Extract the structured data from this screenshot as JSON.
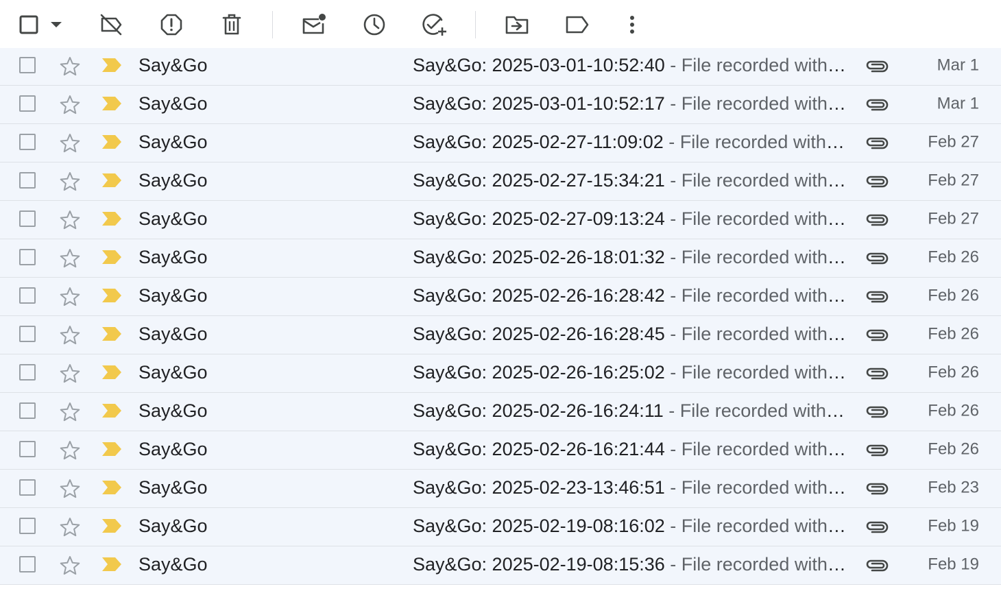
{
  "toolbar": {
    "buttons": [
      {
        "name": "select-all-checkbox"
      },
      {
        "name": "select-dropdown"
      },
      {
        "name": "not-important-button",
        "icon": "label-off-icon"
      },
      {
        "name": "report-spam-button",
        "icon": "report-icon"
      },
      {
        "name": "delete-button",
        "icon": "trash-icon"
      },
      {
        "name": "mark-unread-button",
        "icon": "mark-unread-icon"
      },
      {
        "name": "snooze-button",
        "icon": "clock-icon"
      },
      {
        "name": "add-to-tasks-button",
        "icon": "add-task-icon"
      },
      {
        "name": "move-to-button",
        "icon": "folder-move-icon"
      },
      {
        "name": "labels-button",
        "icon": "label-icon"
      },
      {
        "name": "more-button",
        "icon": "more-vert-icon"
      }
    ]
  },
  "colors": {
    "row_bg": "#f2f6fc",
    "importance": "#f2c94c",
    "icon": "#444746",
    "muted": "#5f6368"
  },
  "emails": [
    {
      "sender": "Say&Go",
      "subject": "Say&Go: 2025-03-01-10:52:40",
      "snippet": " - File recorded with Say&Go",
      "date": "Mar 1"
    },
    {
      "sender": "Say&Go",
      "subject": "Say&Go: 2025-03-01-10:52:17",
      "snippet": " - File recorded with Say&Go",
      "date": "Mar 1"
    },
    {
      "sender": "Say&Go",
      "subject": "Say&Go: 2025-02-27-11:09:02",
      "snippet": " - File recorded with Say&Go",
      "date": "Feb 27"
    },
    {
      "sender": "Say&Go",
      "subject": "Say&Go: 2025-02-27-15:34:21",
      "snippet": " - File recorded with Say&Go",
      "date": "Feb 27"
    },
    {
      "sender": "Say&Go",
      "subject": "Say&Go: 2025-02-27-09:13:24",
      "snippet": " - File recorded with Say&Go",
      "date": "Feb 27"
    },
    {
      "sender": "Say&Go",
      "subject": "Say&Go: 2025-02-26-18:01:32",
      "snippet": " - File recorded with Say&Go",
      "date": "Feb 26"
    },
    {
      "sender": "Say&Go",
      "subject": "Say&Go: 2025-02-26-16:28:42",
      "snippet": " - File recorded with Say&Go",
      "date": "Feb 26"
    },
    {
      "sender": "Say&Go",
      "subject": "Say&Go: 2025-02-26-16:28:45",
      "snippet": " - File recorded with Say&Go",
      "date": "Feb 26"
    },
    {
      "sender": "Say&Go",
      "subject": "Say&Go: 2025-02-26-16:25:02",
      "snippet": " - File recorded with Say&Go",
      "date": "Feb 26"
    },
    {
      "sender": "Say&Go",
      "subject": "Say&Go: 2025-02-26-16:24:11",
      "snippet": " - File recorded with Say&Go",
      "date": "Feb 26"
    },
    {
      "sender": "Say&Go",
      "subject": "Say&Go: 2025-02-26-16:21:44",
      "snippet": " - File recorded with Say&Go",
      "date": "Feb 26"
    },
    {
      "sender": "Say&Go",
      "subject": "Say&Go: 2025-02-23-13:46:51",
      "snippet": " - File recorded with Say&Go",
      "date": "Feb 23"
    },
    {
      "sender": "Say&Go",
      "subject": "Say&Go: 2025-02-19-08:16:02",
      "snippet": " - File recorded with Say&Go",
      "date": "Feb 19"
    },
    {
      "sender": "Say&Go",
      "subject": "Say&Go: 2025-02-19-08:15:36",
      "snippet": " - File recorded with Say&Go",
      "date": "Feb 19"
    }
  ]
}
